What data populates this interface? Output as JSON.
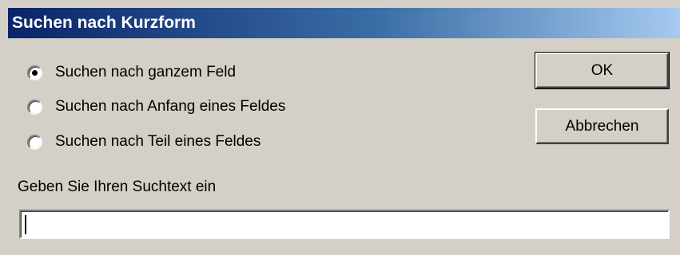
{
  "window": {
    "title": "Suchen nach Kurzform"
  },
  "search_mode": {
    "options": [
      {
        "label": "Suchen nach ganzem Feld",
        "selected": true
      },
      {
        "label": "Suchen nach Anfang eines Feldes",
        "selected": false
      },
      {
        "label": "Suchen nach Teil eines Feldes",
        "selected": false
      }
    ]
  },
  "buttons": {
    "ok_label": "OK",
    "cancel_label": "Abbrechen"
  },
  "search": {
    "prompt": "Geben Sie Ihren Suchtext ein",
    "value": ""
  },
  "colors": {
    "title_start": "#0a246a",
    "title_end": "#a6caf0",
    "face": "#d4d0c8"
  }
}
